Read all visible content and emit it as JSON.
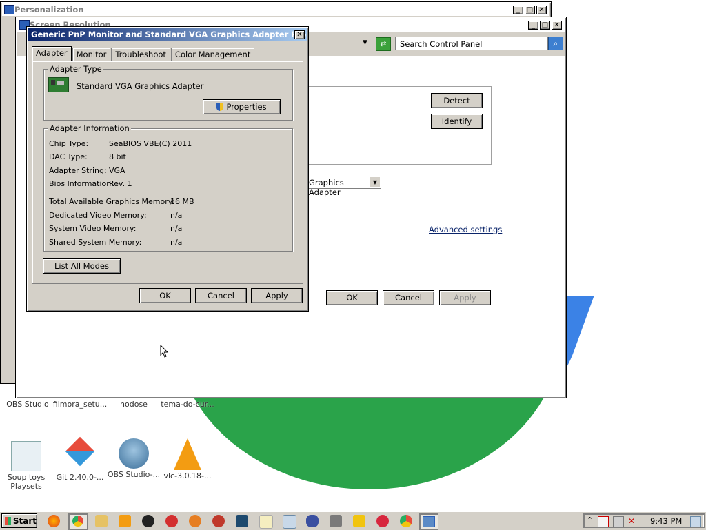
{
  "background_windows": {
    "personalization": {
      "title": "Personalization"
    },
    "screen_resolution": {
      "title": "Screen Resolution",
      "search_placeholder": "Search Control Panel",
      "detect_label": "Detect",
      "identify_label": "Identify",
      "display_dropdown_value": "Graphics Adapter",
      "advanced_settings_label": "Advanced settings",
      "ok_label": "OK",
      "cancel_label": "Cancel",
      "apply_label": "Apply"
    }
  },
  "dialog": {
    "title": "Generic PnP Monitor and Standard VGA Graphics Adapter Properties",
    "tabs": [
      "Adapter",
      "Monitor",
      "Troubleshoot",
      "Color Management"
    ],
    "active_tab": "Adapter",
    "adapter_type": {
      "group_label": "Adapter Type",
      "name": "Standard VGA Graphics Adapter",
      "properties_label": "Properties"
    },
    "adapter_info": {
      "group_label": "Adapter Information",
      "rows": [
        {
          "label": "Chip Type:",
          "value": "SeaBIOS VBE(C) 2011"
        },
        {
          "label": "DAC Type:",
          "value": "8 bit"
        },
        {
          "label": "Adapter String:",
          "value": "VGA"
        },
        {
          "label": "Bios Information:",
          "value": "Rev. 1"
        }
      ],
      "memory_rows": [
        {
          "label": "Total Available Graphics Memory:",
          "value": "16 MB"
        },
        {
          "label": "Dedicated Video Memory:",
          "value": "n/a"
        },
        {
          "label": "System Video Memory:",
          "value": "n/a"
        },
        {
          "label": "Shared System Memory:",
          "value": "n/a"
        }
      ]
    },
    "list_all_modes_label": "List All Modes",
    "ok_label": "OK",
    "cancel_label": "Cancel",
    "apply_label": "Apply"
  },
  "desktop_icons_row1": [
    "OBS Studio",
    "filmora_setu...",
    "nodose",
    "tema-do-cur..."
  ],
  "desktop_icons_row2": [
    "Soup toys\nPlaysets",
    "Git 2.40.0-...",
    "OBS Studio-...",
    "vlc-3.0.18-..."
  ],
  "taskbar": {
    "start_label": "Start",
    "clock": "9:43 PM"
  },
  "colors": {
    "wallpaper_green": "#2aa34a",
    "wallpaper_blue": "#3b82e6",
    "active_title": "#0a246a",
    "face": "#d4d0c8"
  }
}
